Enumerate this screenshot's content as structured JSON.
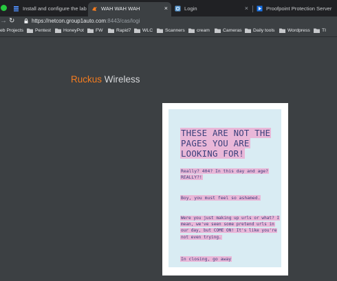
{
  "tabs": [
    {
      "title": "Install and configure the lab | S",
      "favicon": "stack-icon",
      "active": false
    },
    {
      "title": "WAH WAH WAH",
      "favicon": "ruckus-dog-icon",
      "active": true
    },
    {
      "title": "Login",
      "favicon": "globe-icon",
      "active": false
    },
    {
      "title": "Proofpoint Protection Server",
      "favicon": "proofpoint-icon",
      "active": false
    }
  ],
  "close_glyph": "×",
  "address_bar": {
    "host": "https://netcon.group1auto.com",
    "path": ":8443/cas/logi"
  },
  "bookmarks": [
    {
      "label": "eb Projects",
      "icon": ""
    },
    {
      "label": "Pentest",
      "icon": "folder-icon"
    },
    {
      "label": "HoneyPot",
      "icon": "folder-icon"
    },
    {
      "label": "FW",
      "icon": "folder-icon"
    },
    {
      "label": "Rapid7",
      "icon": "folder-icon"
    },
    {
      "label": "WLC",
      "icon": "folder-icon"
    },
    {
      "label": "Scanners",
      "icon": "folder-icon"
    },
    {
      "label": "cream",
      "icon": "folder-icon"
    },
    {
      "label": "Cameras",
      "icon": "folder-icon"
    },
    {
      "label": "Daily tools",
      "icon": "folder-icon"
    },
    {
      "label": "Wordpress",
      "icon": "folder-icon"
    },
    {
      "label": "TI",
      "icon": "folder-icon"
    }
  ],
  "brand": {
    "part1": "Ruckus",
    "part2": "Wireless",
    "accent": "#f47c20"
  },
  "error_card": {
    "headline": "THESE ARE NOT THE PAGES YOU ARE LOOKING FOR!",
    "p1": "Really? 404? In this day and age? REALLY?!",
    "p2": "Boy, you must feel so ashamed.",
    "p3": "Were you just making up urls or what? I mean, we've seen some pretend urls in our day, but COME ON! It's like you're not even trying.",
    "p4": "In closing, go away",
    "highlight_color": "#e9b7d8",
    "text_color": "#3a3f7a",
    "background_color": "#d9ecf3"
  }
}
